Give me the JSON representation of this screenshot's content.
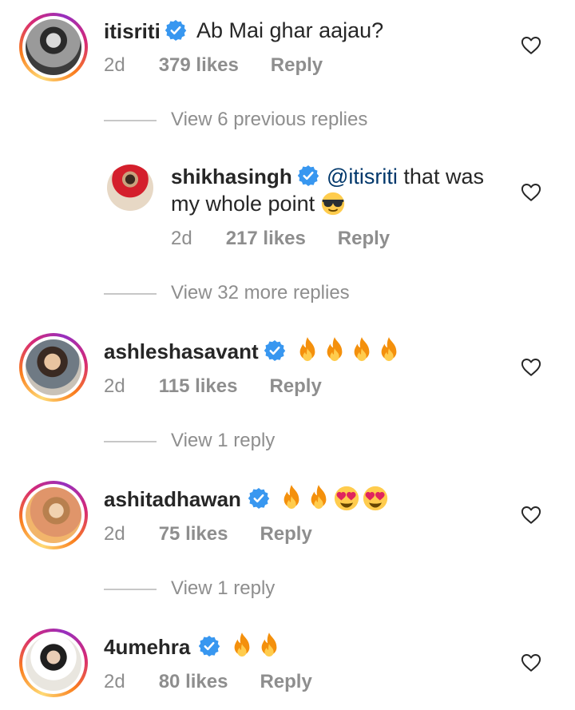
{
  "comments": [
    {
      "username": "itisriti",
      "text": "Ab Mai ghar aajau?",
      "time": "2d",
      "likes": "379 likes",
      "reply": "Reply"
    },
    {
      "username": "shikhasingh",
      "mention": "@itisriti",
      "text_line1": " that was",
      "text_line2": "my whole point",
      "time": "2d",
      "likes": "217 likes",
      "reply": "Reply"
    },
    {
      "username": "ashleshasavant",
      "time": "2d",
      "likes": "115 likes",
      "reply": "Reply"
    },
    {
      "username": "ashitadhawan",
      "time": "2d",
      "likes": "75 likes",
      "reply": "Reply"
    },
    {
      "username": "4umehra",
      "time": "2d",
      "likes": "80 likes",
      "reply": "Reply"
    }
  ],
  "view_replies": [
    "View 6 previous replies",
    "View 32 more replies",
    "View 1 reply",
    "View 1 reply"
  ],
  "colors": {
    "verified": "#3897f0",
    "meta": "#8e8e8e",
    "mention": "#00376b"
  }
}
